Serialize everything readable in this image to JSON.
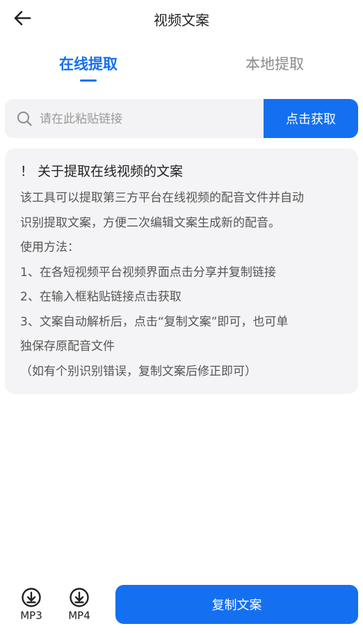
{
  "header": {
    "title": "视频文案",
    "back_icon": "arrow-left-icon"
  },
  "tabs": [
    {
      "label": "在线提取",
      "active": true
    },
    {
      "label": "本地提取",
      "active": false
    }
  ],
  "search": {
    "placeholder": "请在此粘贴链接",
    "value": "",
    "button_label": "点击获取"
  },
  "info": {
    "title": "！ 关于提取在线视频的文案",
    "lines": [
      "该工具可以提取第三方平台在线视频的配音文件并自动",
      "识别提取文案，方便二次编辑文案生成新的配音。",
      "使用方法：",
      "1、在各短视频平台视频界面点击分享并复制链接",
      "2、在输入框粘贴链接点击获取",
      "3、文案自动解析后，点击“复制文案”即可，也可单",
      "独保存原配音文件",
      "（如有个别识别错误，复制文案后修正即可）"
    ]
  },
  "bottom": {
    "mp3_label": "MP3",
    "mp4_label": "MP4",
    "copy_label": "复制文案",
    "download_icon": "download-circle-icon"
  },
  "colors": {
    "accent": "#1470f0",
    "tab_inactive": "#8a8a8a",
    "panel_bg": "#f4f4f6"
  }
}
